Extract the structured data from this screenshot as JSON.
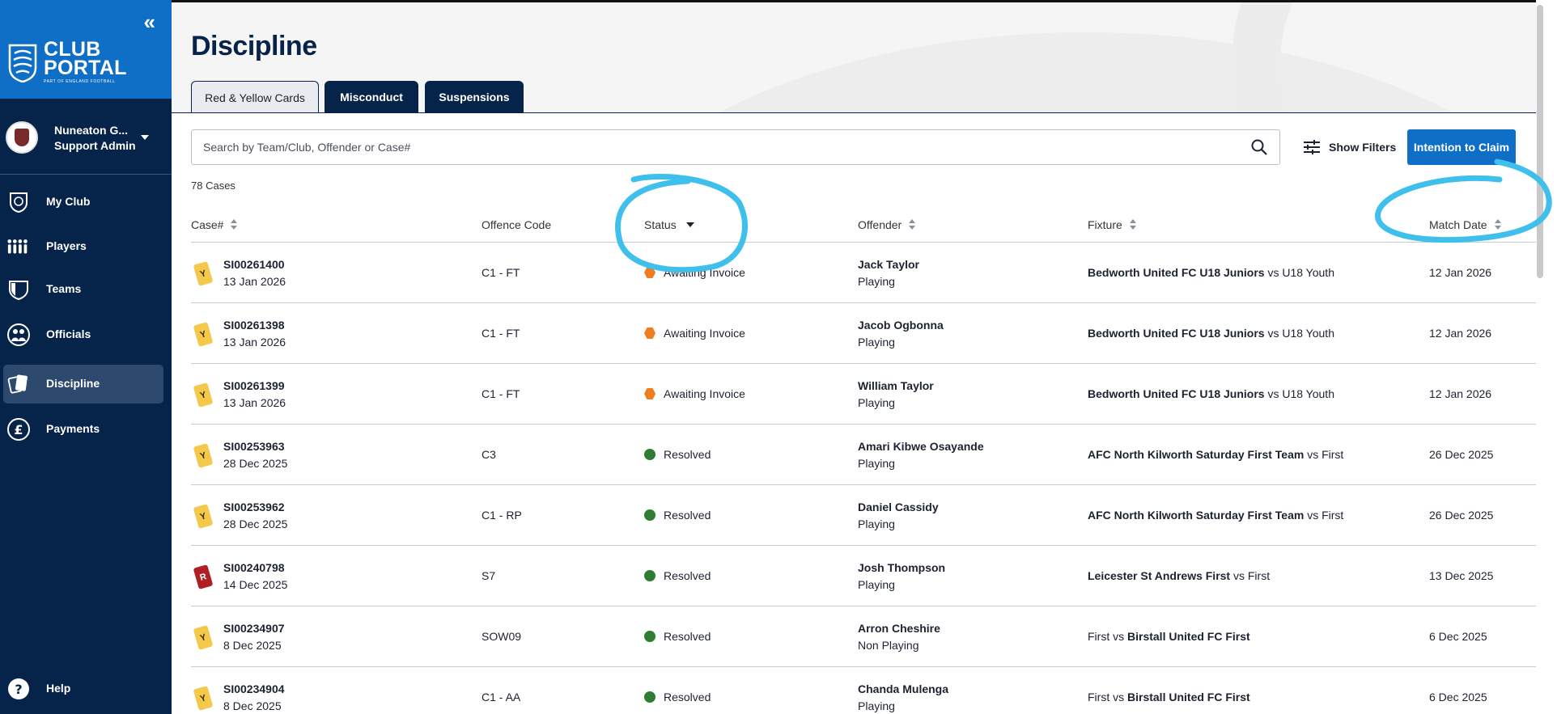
{
  "sidebar": {
    "collapse_label": "«",
    "logo": {
      "line1": "CLUB",
      "line2": "PORTAL",
      "tagline": "PART OF ENGLAND FOOTBALL"
    },
    "account": {
      "name": "Nuneaton G...",
      "role": "Support Admin"
    },
    "nav": [
      {
        "label": "My Club",
        "icon": "shield-ball-icon"
      },
      {
        "label": "Players",
        "icon": "players-group-icon"
      },
      {
        "label": "Teams",
        "icon": "team-shield-icon"
      },
      {
        "label": "Officials",
        "icon": "officials-icon"
      },
      {
        "label": "Discipline",
        "icon": "cards-icon",
        "active": true
      },
      {
        "label": "Payments",
        "icon": "pound-icon"
      }
    ],
    "help_label": "Help"
  },
  "page": {
    "title": "Discipline",
    "tabs": [
      {
        "label": "Red & Yellow Cards",
        "active": true
      },
      {
        "label": "Misconduct"
      },
      {
        "label": "Suspensions"
      }
    ],
    "search_placeholder": "Search by Team/Club, Offender or Case#",
    "show_filters_label": "Show Filters",
    "claim_label": "Intention to Claim",
    "case_count": "78 Cases"
  },
  "table": {
    "columns": [
      "Case#",
      "Offence Code",
      "Status",
      "Offender",
      "Fixture",
      "Match Date"
    ],
    "rows": [
      {
        "card": "Y",
        "case": "SI00261400",
        "date": "13 Jan 2026",
        "offence": "C1 - FT",
        "status": "Awaiting Invoice",
        "offender": "Jack Taylor",
        "role": "Playing",
        "fixture_bold": "Bedworth United FC U18 Juniors",
        "fixture_rest": " vs U18 Youth",
        "fixture_bold_first": true,
        "match_date": "12 Jan 2026"
      },
      {
        "card": "Y",
        "case": "SI00261398",
        "date": "13 Jan 2026",
        "offence": "C1 - FT",
        "status": "Awaiting Invoice",
        "offender": "Jacob Ogbonna",
        "role": "Playing",
        "fixture_bold": "Bedworth United FC U18 Juniors",
        "fixture_rest": " vs U18 Youth",
        "fixture_bold_first": true,
        "match_date": "12 Jan 2026"
      },
      {
        "card": "Y",
        "case": "SI00261399",
        "date": "13 Jan 2026",
        "offence": "C1 - FT",
        "status": "Awaiting Invoice",
        "offender": "William Taylor",
        "role": "Playing",
        "fixture_bold": "Bedworth United FC U18 Juniors",
        "fixture_rest": " vs U18 Youth",
        "fixture_bold_first": true,
        "match_date": "12 Jan 2026"
      },
      {
        "card": "Y",
        "case": "SI00253963",
        "date": "28 Dec 2025",
        "offence": "C3",
        "status": "Resolved",
        "offender": "Amari Kibwe Osayande",
        "role": "Playing",
        "fixture_bold": "AFC North Kilworth Saturday First Team",
        "fixture_rest": " vs First",
        "fixture_bold_first": true,
        "match_date": "26 Dec 2025"
      },
      {
        "card": "Y",
        "case": "SI00253962",
        "date": "28 Dec 2025",
        "offence": "C1 - RP",
        "status": "Resolved",
        "offender": "Daniel Cassidy",
        "role": "Playing",
        "fixture_bold": "AFC North Kilworth Saturday First Team",
        "fixture_rest": " vs First",
        "fixture_bold_first": true,
        "match_date": "26 Dec 2025"
      },
      {
        "card": "R",
        "case": "SI00240798",
        "date": "14 Dec 2025",
        "offence": "S7",
        "status": "Resolved",
        "offender": "Josh Thompson",
        "role": "Playing",
        "fixture_bold": "Leicester St Andrews First",
        "fixture_rest": " vs First",
        "fixture_bold_first": true,
        "match_date": "13 Dec 2025"
      },
      {
        "card": "Y",
        "case": "SI00234907",
        "date": "8 Dec 2025",
        "offence": "SOW09",
        "status": "Resolved",
        "offender": "Arron Cheshire",
        "role": "Non Playing",
        "fixture_bold": "Birstall United FC First",
        "fixture_rest": "First vs ",
        "fixture_bold_first": false,
        "match_date": "6 Dec 2025"
      },
      {
        "card": "Y",
        "case": "SI00234904",
        "date": "8 Dec 2025",
        "offence": "C1 - AA",
        "status": "Resolved",
        "offender": "Chanda Mulenga",
        "role": "Playing",
        "fixture_bold": "Birstall United FC First",
        "fixture_rest": "First vs ",
        "fixture_bold_first": false,
        "match_date": "6 Dec 2025"
      }
    ]
  },
  "colors": {
    "sidebar": "#06234a",
    "brand_blue": "#0f6fc6",
    "awaiting": "#ef7d22",
    "resolved": "#2e7d32",
    "yellow_card": "#f3c84b",
    "red_card": "#b01f24",
    "annotation": "#3fc0ec"
  }
}
